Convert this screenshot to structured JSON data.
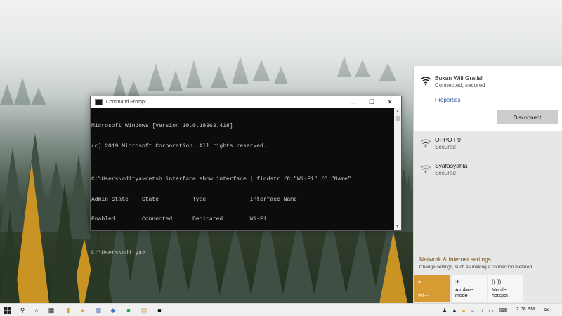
{
  "cmd": {
    "title": "Command Prompt",
    "lines": [
      "Microsoft Windows [Version 10.0.18363.418]",
      "(c) 2019 Microsoft Corporation. All rights reserved.",
      "",
      "C:\\Users\\aditya>netsh interface show interface | findstr /C:\"Wi-Fi\" /C:\"Name\"",
      "Admin State    State          Type             Interface Name",
      "Enabled        Connected      Dedicated        Wi-Fi",
      "",
      "C:\\Users\\aditya>"
    ]
  },
  "network": {
    "active": {
      "name": "Bukan Wifi Gratis!",
      "status": "Connected, secured",
      "properties_label": "Properties",
      "disconnect_label": "Disconnect"
    },
    "others": [
      {
        "name": "OPPO F9",
        "status": "Secured"
      },
      {
        "name": "Syafasyahla",
        "status": "Secured"
      }
    ],
    "settings_title": "Network & Internet settings",
    "settings_subtitle": "Change settings, such as making a connection metered.",
    "tiles": {
      "wifi": "Wi-Fi",
      "airplane": "Airplane mode",
      "hotspot_line1": "Mobile",
      "hotspot_line2": "hotspot"
    }
  },
  "taskbar": {
    "time": "2:08 PM"
  },
  "colors": {
    "accent": "#d89a32",
    "link": "#1f4e8c"
  }
}
